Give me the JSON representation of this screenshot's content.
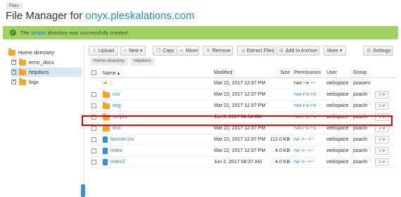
{
  "top_crumb": "Files",
  "title": {
    "prefix": "File Manager for",
    "domain": "onyx.pleskalations.com"
  },
  "notice": {
    "pre": "The",
    "link": "scripts",
    "post": "directory was successfully created."
  },
  "sidebar": {
    "items": [
      {
        "label": "Home directory"
      },
      {
        "label": "error_docs",
        "expander": "+"
      },
      {
        "label": "httpdocs",
        "expander": "+"
      },
      {
        "label": "logs",
        "expander": "+"
      }
    ]
  },
  "toolbar": {
    "upload": "Upload",
    "new": "New ▾",
    "copy": "Copy",
    "move": "Move",
    "remove": "Remove",
    "extract": "Extract Files",
    "add_archive": "Add to Archive",
    "more": "More ▾",
    "settings": "Settings"
  },
  "breadcrumbs": [
    "Home directory",
    "httpdocs"
  ],
  "table": {
    "headers": {
      "name": "Name ▴",
      "modified": "Modified",
      "size": "Size",
      "permissions": "Permissions",
      "user": "User",
      "group": "Group"
    },
    "rows": [
      {
        "name": "..",
        "modified": "Mar 22, 2017 12:37 PM",
        "size": "",
        "perm": "rwx --x ---",
        "user": "webspace",
        "group": "psaserv"
      },
      {
        "name": "css",
        "modified": "Mar 22, 2017 12:37 PM",
        "size": "",
        "perm": "rwx r-x r-x",
        "user": "webspace",
        "group": "psacln"
      },
      {
        "name": "img",
        "modified": "Mar 22, 2017 12:37 PM",
        "size": "",
        "perm": "rwx r-x r-x",
        "user": "webspace",
        "group": "psacln"
      },
      {
        "name": "scripts",
        "modified": "Jun 2, 2017 08:54 AM",
        "size": "",
        "perm": "rwx r-x r-x",
        "user": "webspace",
        "group": "psacln"
      },
      {
        "name": "test",
        "modified": "Mar 22, 2017 12:37 PM",
        "size": "",
        "perm": "rwx r-x r-x",
        "user": "webspace",
        "group": "psacln"
      },
      {
        "name": "favicon.ico",
        "modified": "Mar 22, 2017 12:37 PM",
        "size": "112.0 KB",
        "perm": "rw- r-- r--",
        "user": "webspace",
        "group": "psacln"
      },
      {
        "name": "index",
        "modified": "Mar 22, 2017 12:37 PM",
        "size": "4.0 KB",
        "perm": "rw- r-- r--",
        "user": "webspace",
        "group": "psacln"
      },
      {
        "name": "index2",
        "modified": "Jun 2, 2017 08:37 AM",
        "size": "4.0 KB",
        "perm": "rw- r-- r--",
        "user": "webspace",
        "group": "psacln"
      }
    ],
    "menu_label": "≡ ▾"
  },
  "colors": {
    "accent": "#2a8ec9",
    "success": "#9dd35e",
    "folder": "#f5a623",
    "highlight": "#e00000"
  }
}
